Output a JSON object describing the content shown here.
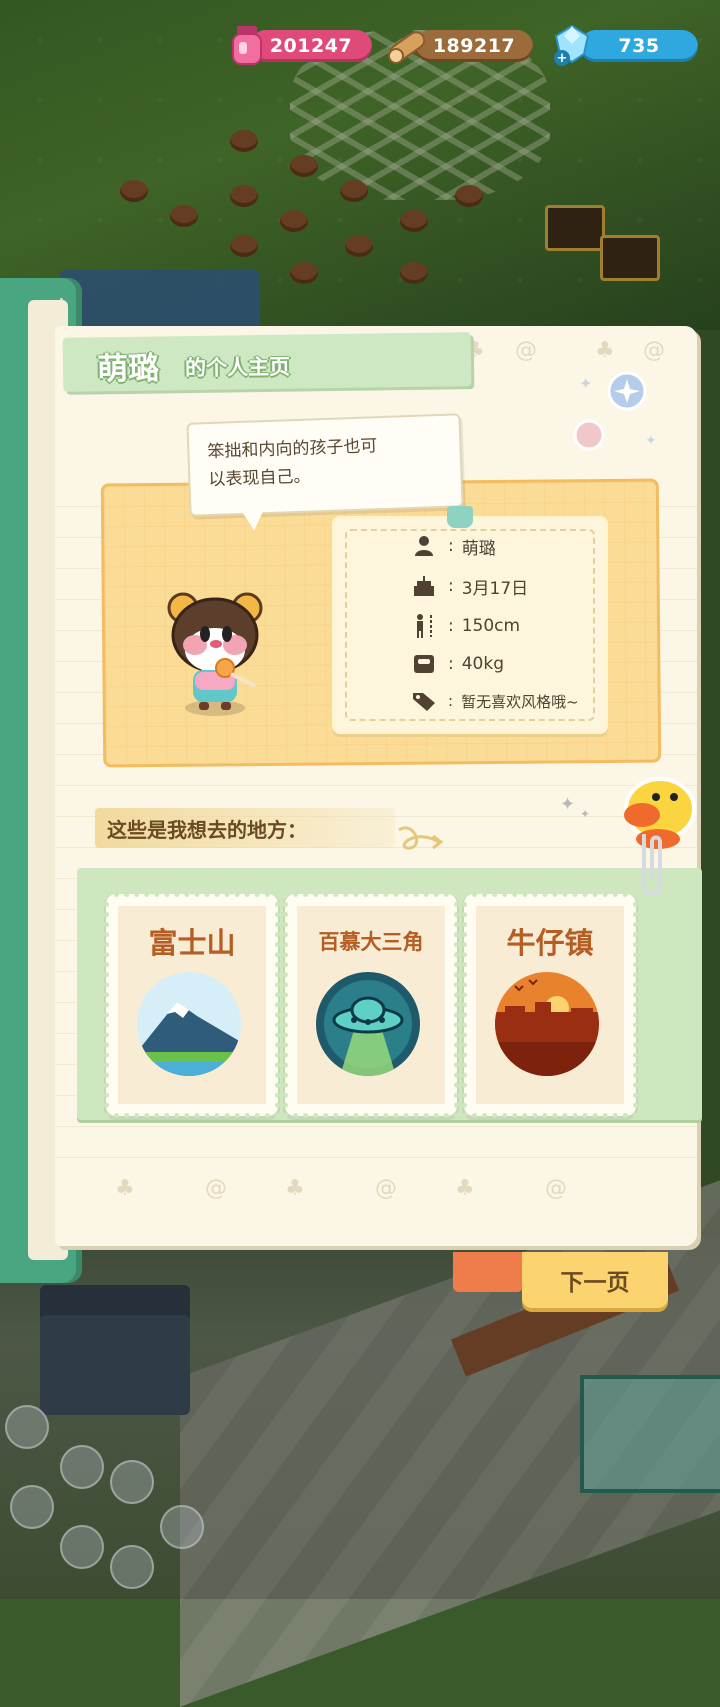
{
  "currency": {
    "pink_value": "201247",
    "wood_value": "189217",
    "gem_value": "735",
    "pink_icon": "potion-jar-icon",
    "wood_icon": "wood-log-icon",
    "gem_icon": "diamond-plus-icon"
  },
  "profile": {
    "name": "萌璐",
    "title_suffix": "的个人主页",
    "bio_line1": "笨拙和内向的孩子也可",
    "bio_line2": "以表现自己。",
    "fields": [
      {
        "icon": "person-icon",
        "value": "萌璐"
      },
      {
        "icon": "birthday-cake-icon",
        "value": "3月17日"
      },
      {
        "icon": "height-icon",
        "value": "150cm"
      },
      {
        "icon": "weight-scale-icon",
        "value": "40kg"
      },
      {
        "icon": "tag-icon",
        "value": "暂无喜欢风格哦~"
      }
    ]
  },
  "places": {
    "heading": "这些是我想去的地方：",
    "items": [
      {
        "label": "富士山",
        "scene": "mountain-scene"
      },
      {
        "label": "百慕大三角",
        "scene": "ufo-scene"
      },
      {
        "label": "牛仔镇",
        "scene": "sunset-town-scene"
      }
    ]
  },
  "navigation": {
    "next_page": "下一页"
  },
  "colors": {
    "banner": "#cde8c3",
    "profile_card": "#fbdc97",
    "next_button": "#fbd46f",
    "cover": "#4aa681"
  }
}
